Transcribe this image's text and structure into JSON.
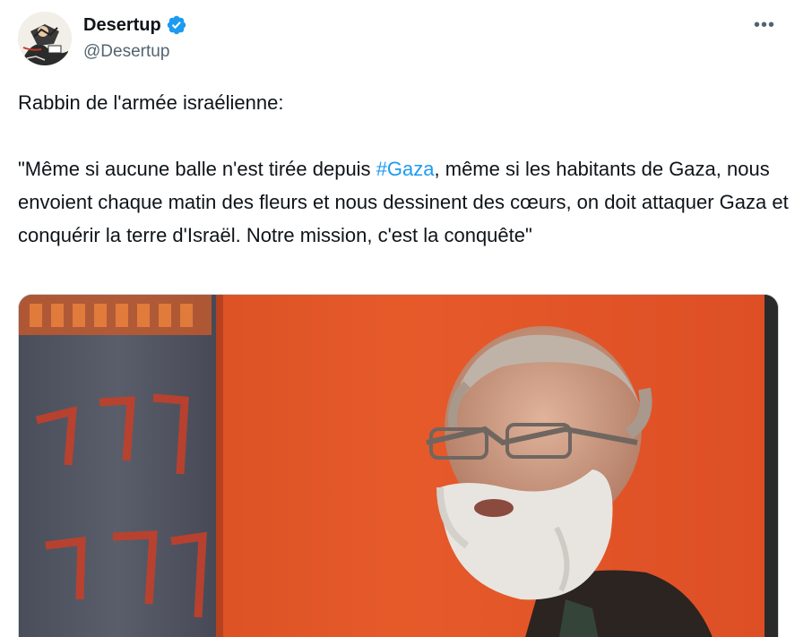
{
  "author": {
    "display_name": "Desertup",
    "handle": "@Desertup",
    "verified": true,
    "avatar_icon": "cartoon-avatar-icon"
  },
  "menu": {
    "more_icon": "more-options-icon",
    "more_label": "•••"
  },
  "tweet": {
    "line1": "Rabbin de l'armée israélienne:",
    "quote_before": "\"Même si aucune balle n'est tirée depuis ",
    "hashtag": "#Gaza",
    "quote_after": ", même si les habitants de Gaza, nous envoient chaque matin des fleurs et nous dessinent des cœurs, on doit attaquer Gaza et conquérir la terre d'Israël. Notre mission, c'est la conquête\""
  },
  "media": {
    "type": "video-thumbnail",
    "icon": "video-thumbnail-image"
  },
  "colors": {
    "text": "#0f1419",
    "secondary": "#536471",
    "link": "#1d9bf0",
    "verified_badge": "#1d9bf0",
    "media_background": "#c64520"
  }
}
